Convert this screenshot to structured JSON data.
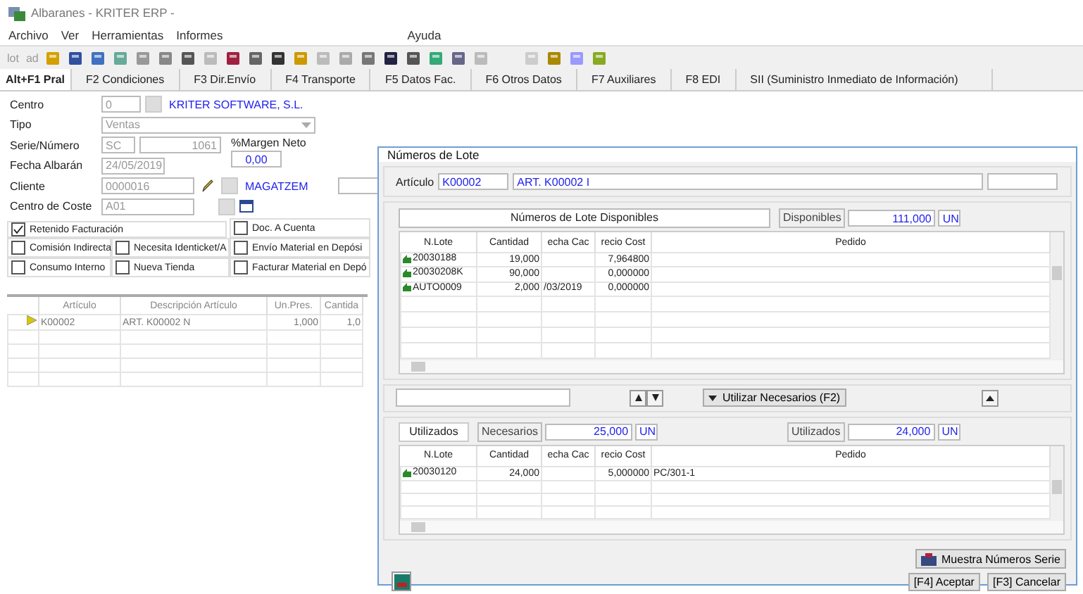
{
  "window": {
    "title": "Albaranes - KRITER ERP -"
  },
  "menu": {
    "items": [
      "Archivo",
      "Ver",
      "Herramientas",
      "Informes"
    ],
    "help": "Ayuda"
  },
  "toolbar": {
    "labels": [
      "lot",
      "ad"
    ]
  },
  "tabs": [
    {
      "label": "Alt+F1 Pral",
      "selected": true
    },
    {
      "label": "F2 Condiciones",
      "selected": false
    },
    {
      "label": "F3 Dir.Envío",
      "selected": false
    },
    {
      "label": "F4 Transporte",
      "selected": false
    },
    {
      "label": "F5 Datos Fac.",
      "selected": false
    },
    {
      "label": "F6 Otros Datos",
      "selected": false
    },
    {
      "label": "F7 Auxiliares",
      "selected": false
    },
    {
      "label": "F8 EDI",
      "selected": false
    },
    {
      "label": "SII (Suministro Inmediato de Información)",
      "selected": false
    }
  ],
  "form": {
    "centro_label": "Centro",
    "centro": "0",
    "empresa": "KRITER SOFTWARE, S.L.",
    "tipo_label": "Tipo",
    "tipo": "Ventas",
    "serie_label": "Serie/Número",
    "serie": "SC",
    "numero": "1061",
    "margen_label": "%Margen Neto",
    "margen": "0,00",
    "fecha_label": "Fecha Albarán",
    "fecha": "24/05/2019",
    "cliente_label": "Cliente",
    "cliente": "0000016",
    "almacen": "MAGATZEM",
    "coste_label": "Centro de Coste",
    "coste": "A01"
  },
  "option_columns": [
    [
      {
        "label": "Retenido Facturación",
        "checked": true
      },
      {
        "label": "Comisión Indirecta",
        "checked": false
      },
      {
        "label": "Consumo Interno",
        "checked": false
      }
    ],
    [
      {
        "label": "Necesita Identicket/A",
        "checked": false
      },
      {
        "label": "Nueva Tienda",
        "checked": false
      }
    ],
    [
      {
        "label": "Doc. A Cuenta",
        "checked": false
      },
      {
        "label": "Envío Material en Depósi",
        "checked": false
      },
      {
        "label": "Facturar Material en Depó",
        "checked": false
      }
    ]
  ],
  "lines": {
    "columns": [
      "Artículo",
      "Descripción Artículo",
      "Un.Pres.",
      "Cantida"
    ],
    "rows": [
      {
        "cells": [
          "K00002",
          "ART. K00002 N",
          "1,000",
          "1,0"
        ]
      }
    ]
  },
  "dialog": {
    "title": "Números de Lote",
    "articulo_label": "Artículo",
    "articulo": "K00002",
    "descripcion": "ART. K00002 I",
    "available": {
      "header": "Números de Lote Disponibles",
      "total_label": "Disponibles",
      "total": "111,000",
      "unit": "UN",
      "columns": [
        "N.Lote",
        "Cantidad",
        "echa Cac",
        "recio Cost",
        "Pedido"
      ],
      "rows": [
        {
          "cells": [
            "20030188",
            "19,000",
            "",
            "7,964800",
            ""
          ]
        },
        {
          "cells": [
            "20030208K",
            "90,000",
            "",
            "0,000000",
            ""
          ]
        },
        {
          "cells": [
            "AUTO0009",
            "2,000",
            "/03/2019",
            "0,000000",
            ""
          ]
        }
      ]
    },
    "use_button": "Utilizar Necesarios (F2)",
    "used": {
      "tab": "Utilizados",
      "needed_label": "Necesarios",
      "needed": "25,000",
      "needed_unit": "UN",
      "used_label": "Utilizados",
      "used": "24,000",
      "used_unit": "UN",
      "columns": [
        "N.Lote",
        "Cantidad",
        "echa Cac",
        "recio Cost",
        "Pedido"
      ],
      "rows": [
        {
          "cells": [
            "20030120",
            "24,000",
            "",
            "5,000000",
            "PC/301-1"
          ]
        }
      ]
    },
    "serial_button": "Muestra Números Serie",
    "accept": "[F4] Aceptar",
    "cancel": "[F3] Cancelar"
  }
}
